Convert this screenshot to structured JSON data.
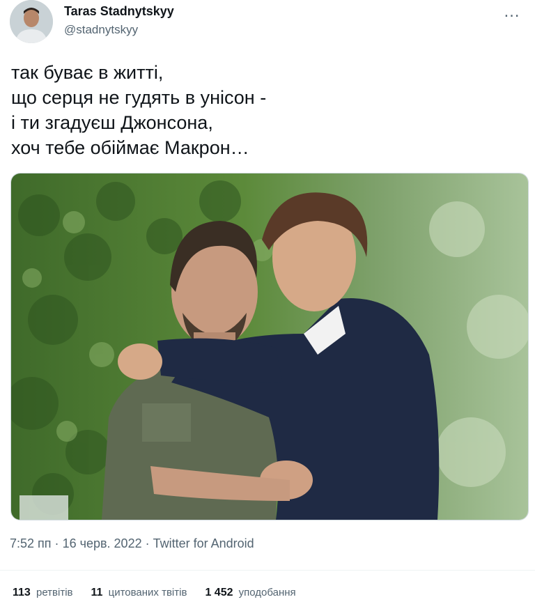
{
  "author": {
    "name": "Taras Stadnytskyy",
    "handle": "@stadnytskyy"
  },
  "more_icon": "…",
  "tweet": {
    "lines": [
      "так буває в житті,",
      "що серця не гудять в унісон -",
      "і ти згадуєш Джонсона,",
      "хоч тебе обіймає Макрон…"
    ]
  },
  "meta": {
    "time": "7:52 пп",
    "separator": "·",
    "date": "16 черв. 2022",
    "source": "Twitter for Android"
  },
  "stats": {
    "retweets": {
      "count": "113",
      "label": "ретвітів"
    },
    "quotes": {
      "count": "11",
      "label": "цитованих твітів"
    },
    "likes": {
      "count": "1 452",
      "label": "уподобання"
    }
  },
  "colors": {
    "primary_text": "#0f1419",
    "secondary_text": "#536471",
    "divider": "#eff3f4"
  }
}
